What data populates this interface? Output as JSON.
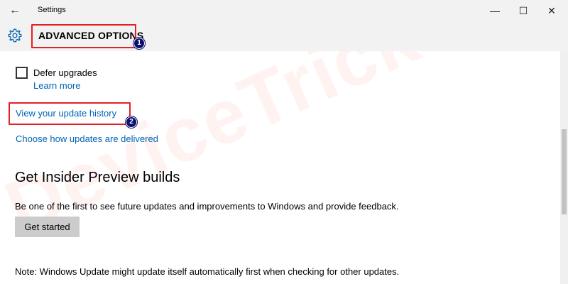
{
  "window": {
    "title": "Settings",
    "controls": {
      "minimize": "—",
      "maximize": "☐",
      "close": "✕"
    }
  },
  "header": {
    "title": "ADVANCED OPTIONS",
    "icon": "gear-icon"
  },
  "callouts": [
    "1",
    "2"
  ],
  "options": {
    "defer_label": "Defer upgrades",
    "defer_checked": false,
    "learn_more": "Learn more",
    "history_link": "View your update history",
    "delivery_link": "Choose how updates are delivered"
  },
  "insider": {
    "title": "Get Insider Preview builds",
    "description": "Be one of the first to see future updates and improvements to Windows and provide feedback.",
    "button": "Get started"
  },
  "note": "Note: Windows Update might update itself automatically first when checking for other updates.",
  "watermark": "DeviceTricks",
  "colors": {
    "link": "#0063b1",
    "callout": "#e32027",
    "badge": "#0a0f6e",
    "titlebar": "#f2f2f2",
    "button": "#cccccc"
  }
}
